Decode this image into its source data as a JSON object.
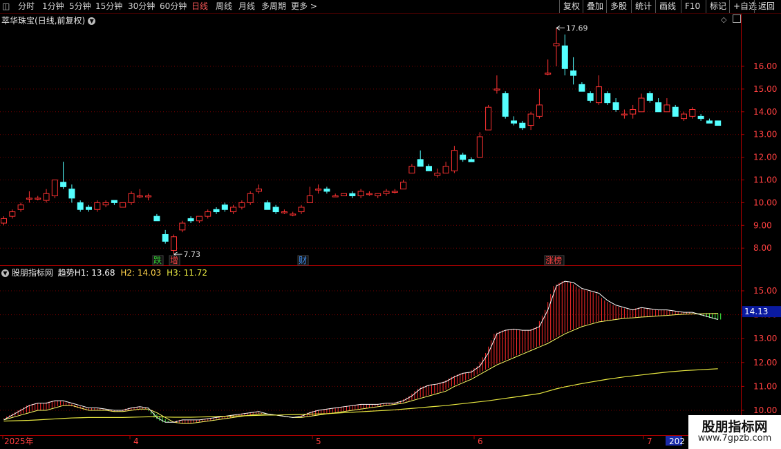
{
  "toolbar": {
    "periods": [
      "分时",
      "1分钟",
      "5分钟",
      "15分钟",
      "30分钟",
      "60分钟",
      "日线",
      "周线",
      "月线",
      "多周期",
      "更多 >"
    ],
    "active_period": "日线",
    "right_buttons": [
      "复权",
      "叠加",
      "多股",
      "统计",
      "画线",
      "F10",
      "标记",
      "+自选",
      "返回"
    ]
  },
  "stock": {
    "name": "萃华珠宝",
    "mode": "(日线,前复权)"
  },
  "indicator": {
    "name": "股朋指标网",
    "label_prefix": "趋势",
    "h1": "H1: 13.68",
    "h2": "H2: 14.03",
    "h3": "H3: 11.72",
    "current_value": "14.13"
  },
  "annotations": {
    "high": "17.69",
    "low": "7.73",
    "tags": [
      {
        "text": "跌",
        "color": "#33cc33"
      },
      {
        "text": "增",
        "color": "#ff4444"
      },
      {
        "text": "财",
        "color": "#4499ff"
      },
      {
        "text": "涨榜",
        "color": "#ff4444"
      }
    ]
  },
  "price_axis": [
    "16.00",
    "15.00",
    "14.00",
    "13.00",
    "12.00",
    "11.00",
    "10.00",
    "9.00",
    "8.00"
  ],
  "indicator_axis": [
    "15.00",
    "14.00",
    "13.00",
    "12.00",
    "11.00",
    "10.00"
  ],
  "date_axis": [
    "2025年",
    "4",
    "5",
    "6",
    "7",
    "202"
  ],
  "colors": {
    "up": "#ff3232",
    "down": "#54ffff",
    "grid": "#7a0000",
    "h3": "#e8e840",
    "bg": "#000000"
  },
  "chart_data": {
    "type": "candlestick",
    "ohlc": [
      [
        9.1,
        9.4,
        9.0,
        9.3
      ],
      [
        9.4,
        9.7,
        9.3,
        9.6
      ],
      [
        9.7,
        10.0,
        9.6,
        9.9
      ],
      [
        10.2,
        10.5,
        10.0,
        10.2
      ],
      [
        10.2,
        10.3,
        10.1,
        10.2
      ],
      [
        10.1,
        10.6,
        10.0,
        10.4
      ],
      [
        10.3,
        11.0,
        10.2,
        11.0
      ],
      [
        10.9,
        11.8,
        10.6,
        10.7
      ],
      [
        10.6,
        10.8,
        10.0,
        10.2
      ],
      [
        10.0,
        10.1,
        9.6,
        9.7
      ],
      [
        9.8,
        9.9,
        9.6,
        9.7
      ],
      [
        9.7,
        10.1,
        9.6,
        10.0
      ],
      [
        9.9,
        10.1,
        9.8,
        10.0
      ],
      [
        10.1,
        10.1,
        9.9,
        10.0
      ],
      [
        9.8,
        10.0,
        9.8,
        10.0
      ],
      [
        10.0,
        10.5,
        9.9,
        10.4
      ],
      [
        10.3,
        10.6,
        10.2,
        10.3
      ],
      [
        10.3,
        10.4,
        10.1,
        10.3
      ],
      [
        9.4,
        9.5,
        9.2,
        9.2
      ],
      [
        8.6,
        8.8,
        8.2,
        8.3
      ],
      [
        7.9,
        8.6,
        7.73,
        8.5
      ],
      [
        8.8,
        9.2,
        8.7,
        9.1
      ],
      [
        9.3,
        9.4,
        9.1,
        9.2
      ],
      [
        9.2,
        9.4,
        9.1,
        9.4
      ],
      [
        9.4,
        9.7,
        9.3,
        9.6
      ],
      [
        9.7,
        9.8,
        9.5,
        9.6
      ],
      [
        9.9,
        10.0,
        9.6,
        9.7
      ],
      [
        9.6,
        9.9,
        9.5,
        9.8
      ],
      [
        9.8,
        10.1,
        9.7,
        10.0
      ],
      [
        10.0,
        10.5,
        9.9,
        10.4
      ],
      [
        10.5,
        10.8,
        10.4,
        10.6
      ],
      [
        10.0,
        10.1,
        9.7,
        9.7
      ],
      [
        9.8,
        9.9,
        9.5,
        9.6
      ],
      [
        9.6,
        9.7,
        9.5,
        9.6
      ],
      [
        9.5,
        9.6,
        9.4,
        9.5
      ],
      [
        9.6,
        9.9,
        9.5,
        9.8
      ],
      [
        10.0,
        10.7,
        10.0,
        10.3
      ],
      [
        10.6,
        10.8,
        10.4,
        10.6
      ],
      [
        10.6,
        10.7,
        10.4,
        10.5
      ],
      [
        10.3,
        10.4,
        10.3,
        10.3
      ],
      [
        10.3,
        10.4,
        10.3,
        10.4
      ],
      [
        10.4,
        10.5,
        10.2,
        10.3
      ],
      [
        10.3,
        10.6,
        10.2,
        10.5
      ],
      [
        10.4,
        10.5,
        10.3,
        10.4
      ],
      [
        10.3,
        10.4,
        10.2,
        10.4
      ],
      [
        10.4,
        10.6,
        10.3,
        10.5
      ],
      [
        10.5,
        10.6,
        10.4,
        10.5
      ],
      [
        10.6,
        11.0,
        10.6,
        10.9
      ],
      [
        11.3,
        11.7,
        11.3,
        11.6
      ],
      [
        11.9,
        12.3,
        11.6,
        11.6
      ],
      [
        11.6,
        11.7,
        11.4,
        11.4
      ],
      [
        11.2,
        11.5,
        11.1,
        11.3
      ],
      [
        11.3,
        11.8,
        11.3,
        11.6
      ],
      [
        11.4,
        12.5,
        11.3,
        12.3
      ],
      [
        12.1,
        12.2,
        11.8,
        11.9
      ],
      [
        11.9,
        12.0,
        11.8,
        11.8
      ],
      [
        12.0,
        13.1,
        12.0,
        12.9
      ],
      [
        13.2,
        14.3,
        13.2,
        14.2
      ],
      [
        15.0,
        15.6,
        14.8,
        15.0
      ],
      [
        14.8,
        14.9,
        13.7,
        13.8
      ],
      [
        13.6,
        13.8,
        13.4,
        13.5
      ],
      [
        13.5,
        13.6,
        13.2,
        13.3
      ],
      [
        13.4,
        14.0,
        13.2,
        13.9
      ],
      [
        13.8,
        15.0,
        13.7,
        14.3
      ],
      [
        15.7,
        16.3,
        15.6,
        15.7
      ],
      [
        16.9,
        17.69,
        16.0,
        17.0
      ],
      [
        16.9,
        17.4,
        15.6,
        15.9
      ],
      [
        15.8,
        16.4,
        15.2,
        15.6
      ],
      [
        15.2,
        15.3,
        14.9,
        14.9
      ],
      [
        14.8,
        14.9,
        14.4,
        14.5
      ],
      [
        14.4,
        15.6,
        14.3,
        15.1
      ],
      [
        14.8,
        14.9,
        14.3,
        14.4
      ],
      [
        14.4,
        14.6,
        14.0,
        14.1
      ],
      [
        13.9,
        14.1,
        13.7,
        13.9
      ],
      [
        13.9,
        14.3,
        13.7,
        14.1
      ],
      [
        14.0,
        14.8,
        14.0,
        14.6
      ],
      [
        14.8,
        14.9,
        14.4,
        14.5
      ],
      [
        14.4,
        14.6,
        14.0,
        14.0
      ],
      [
        14.0,
        14.6,
        14.0,
        14.3
      ],
      [
        14.2,
        14.3,
        13.8,
        13.8
      ],
      [
        13.7,
        14.0,
        13.6,
        13.9
      ],
      [
        13.8,
        14.2,
        13.7,
        14.1
      ],
      [
        13.8,
        13.9,
        13.6,
        13.7
      ],
      [
        13.6,
        13.7,
        13.5,
        13.5
      ],
      [
        13.6,
        13.6,
        13.4,
        13.4
      ]
    ],
    "h1": [
      9.6,
      9.7,
      9.8,
      9.9,
      10.0,
      10.0,
      10.1,
      10.2,
      10.2,
      10.1,
      10.0,
      10.0,
      10.0,
      9.95,
      9.95,
      10.0,
      10.05,
      10.05,
      9.9,
      9.7,
      9.5,
      9.45,
      9.45,
      9.5,
      9.55,
      9.6,
      9.65,
      9.7,
      9.75,
      9.8,
      9.85,
      9.85,
      9.8,
      9.75,
      9.7,
      9.7,
      9.75,
      9.8,
      9.85,
      9.9,
      9.95,
      10.0,
      10.05,
      10.1,
      10.15,
      10.2,
      10.25,
      10.3,
      10.4,
      10.5,
      10.6,
      10.7,
      10.8,
      11.0,
      11.15,
      11.3,
      11.5,
      11.7,
      11.9,
      12.05,
      12.2,
      12.35,
      12.5,
      12.65,
      12.8,
      13.0,
      13.2,
      13.35,
      13.5,
      13.6,
      13.7,
      13.75,
      13.8,
      13.85,
      13.87,
      13.9,
      13.92,
      13.95,
      13.97,
      14.0,
      14.02,
      14.03,
      14.04,
      14.05,
      14.06
    ],
    "h2": [
      9.6,
      9.8,
      10.0,
      10.2,
      10.3,
      10.3,
      10.4,
      10.4,
      10.3,
      10.2,
      10.1,
      10.1,
      10.05,
      10.0,
      10.0,
      10.1,
      10.15,
      10.1,
      9.7,
      9.5,
      9.5,
      9.6,
      9.6,
      9.6,
      9.65,
      9.7,
      9.75,
      9.8,
      9.85,
      9.9,
      9.95,
      9.85,
      9.8,
      9.75,
      9.7,
      9.75,
      9.9,
      10.0,
      10.05,
      10.1,
      10.15,
      10.2,
      10.25,
      10.25,
      10.25,
      10.3,
      10.3,
      10.4,
      10.6,
      10.9,
      11.05,
      11.1,
      11.2,
      11.4,
      11.55,
      11.6,
      11.85,
      12.4,
      13.2,
      13.35,
      13.4,
      13.35,
      13.35,
      13.5,
      14.2,
      15.2,
      15.4,
      15.35,
      15.1,
      15.0,
      14.9,
      14.6,
      14.4,
      14.3,
      14.2,
      14.3,
      14.25,
      14.2,
      14.2,
      14.15,
      14.1,
      14.1,
      14.0,
      13.9,
      13.8
    ],
    "h3": [
      9.55,
      9.56,
      9.57,
      9.58,
      9.6,
      9.62,
      9.64,
      9.66,
      9.68,
      9.69,
      9.7,
      9.7,
      9.7,
      9.7,
      9.7,
      9.71,
      9.72,
      9.73,
      9.73,
      9.72,
      9.71,
      9.71,
      9.71,
      9.72,
      9.73,
      9.74,
      9.75,
      9.76,
      9.77,
      9.78,
      9.79,
      9.8,
      9.8,
      9.81,
      9.82,
      9.83,
      9.84,
      9.85,
      9.86,
      9.88,
      9.9,
      9.92,
      9.94,
      9.96,
      9.98,
      10.0,
      10.02,
      10.05,
      10.08,
      10.11,
      10.14,
      10.17,
      10.2,
      10.24,
      10.28,
      10.32,
      10.36,
      10.4,
      10.45,
      10.5,
      10.55,
      10.6,
      10.65,
      10.7,
      10.8,
      10.9,
      10.98,
      11.05,
      11.12,
      11.18,
      11.24,
      11.3,
      11.35,
      11.4,
      11.44,
      11.48,
      11.52,
      11.56,
      11.6,
      11.63,
      11.66,
      11.68,
      11.7,
      11.72,
      11.74
    ]
  }
}
